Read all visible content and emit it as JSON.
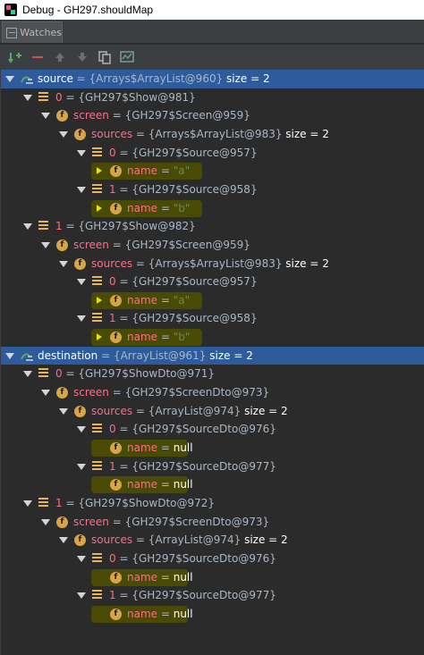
{
  "window": {
    "title": "Debug - GH297.shouldMap"
  },
  "tab": {
    "label": "Watches"
  },
  "toolbar": {
    "buttons": [
      "add-watch",
      "remove-watch",
      "move-up",
      "move-down",
      "copy",
      "show-watches"
    ]
  },
  "colors": {
    "background": "#2b2b2b",
    "selection": "#2d5b9c",
    "highlight": "#4c4e00",
    "name": "#ff6b8a",
    "value": "#a9b7c6",
    "string": "#6a8759"
  },
  "rows": [
    {
      "icon": "watch",
      "arrow": "down",
      "name": "source",
      "value": "{Arrays$ArrayList@960}",
      "size": "size = 2",
      "selected": true
    },
    {
      "icon": "array",
      "arrow": "down",
      "name": "0",
      "value": "{GH297$Show@981}"
    },
    {
      "icon": "field",
      "arrow": "down",
      "name": "screen",
      "value": "{GH297$Screen@959}"
    },
    {
      "icon": "field",
      "arrow": "down",
      "name": "sources",
      "value": "{Arrays$ArrayList@983}",
      "size": "size = 2"
    },
    {
      "icon": "array",
      "arrow": "down",
      "name": "0",
      "value": "{GH297$Source@957}"
    },
    {
      "icon": "field",
      "arrow": "leaf",
      "name": "name",
      "value": "\"a\"",
      "highlight": true,
      "string": true
    },
    {
      "icon": "array",
      "arrow": "down",
      "name": "1",
      "value": "{GH297$Source@958}"
    },
    {
      "icon": "field",
      "arrow": "leaf",
      "name": "name",
      "value": "\"b\"",
      "highlight": true,
      "string": true
    },
    {
      "icon": "array",
      "arrow": "down",
      "name": "1",
      "value": "{GH297$Show@982}"
    },
    {
      "icon": "field",
      "arrow": "down",
      "name": "screen",
      "value": "{GH297$Screen@959}"
    },
    {
      "icon": "field",
      "arrow": "down",
      "name": "sources",
      "value": "{Arrays$ArrayList@983}",
      "size": "size = 2"
    },
    {
      "icon": "array",
      "arrow": "down",
      "name": "0",
      "value": "{GH297$Source@957}"
    },
    {
      "icon": "field",
      "arrow": "leaf",
      "name": "name",
      "value": "\"a\"",
      "highlight": true,
      "string": true
    },
    {
      "icon": "array",
      "arrow": "down",
      "name": "1",
      "value": "{GH297$Source@958}"
    },
    {
      "icon": "field",
      "arrow": "leaf",
      "name": "name",
      "value": "\"b\"",
      "highlight": true,
      "string": true
    },
    {
      "icon": "watch",
      "arrow": "down",
      "name": "destination",
      "value": "{ArrayList@961}",
      "size": "size = 2",
      "selected": true
    },
    {
      "icon": "array",
      "arrow": "down",
      "name": "0",
      "value": "{GH297$ShowDto@971}"
    },
    {
      "icon": "field",
      "arrow": "down",
      "name": "screen",
      "value": "{GH297$ScreenDto@973}"
    },
    {
      "icon": "field",
      "arrow": "down",
      "name": "sources",
      "value": "{ArrayList@974}",
      "size": "size = 2"
    },
    {
      "icon": "array",
      "arrow": "down",
      "name": "0",
      "value": "{GH297$SourceDto@976}"
    },
    {
      "icon": "field",
      "arrow": "none",
      "name": "name",
      "value": "null",
      "highlight": true,
      "null": true
    },
    {
      "icon": "array",
      "arrow": "down",
      "name": "1",
      "value": "{GH297$SourceDto@977}"
    },
    {
      "icon": "field",
      "arrow": "none",
      "name": "name",
      "value": "null",
      "highlight": true,
      "null": true
    },
    {
      "icon": "array",
      "arrow": "down",
      "name": "1",
      "value": "{GH297$ShowDto@972}"
    },
    {
      "icon": "field",
      "arrow": "down",
      "name": "screen",
      "value": "{GH297$ScreenDto@973}"
    },
    {
      "icon": "field",
      "arrow": "down",
      "name": "sources",
      "value": "{ArrayList@974}",
      "size": "size = 2"
    },
    {
      "icon": "array",
      "arrow": "down",
      "name": "0",
      "value": "{GH297$SourceDto@976}"
    },
    {
      "icon": "field",
      "arrow": "none",
      "name": "name",
      "value": "null",
      "highlight": true,
      "null": true
    },
    {
      "icon": "array",
      "arrow": "down",
      "name": "1",
      "value": "{GH297$SourceDto@977}"
    },
    {
      "icon": "field",
      "arrow": "none",
      "name": "name",
      "value": "null",
      "highlight": true,
      "null": true
    }
  ]
}
